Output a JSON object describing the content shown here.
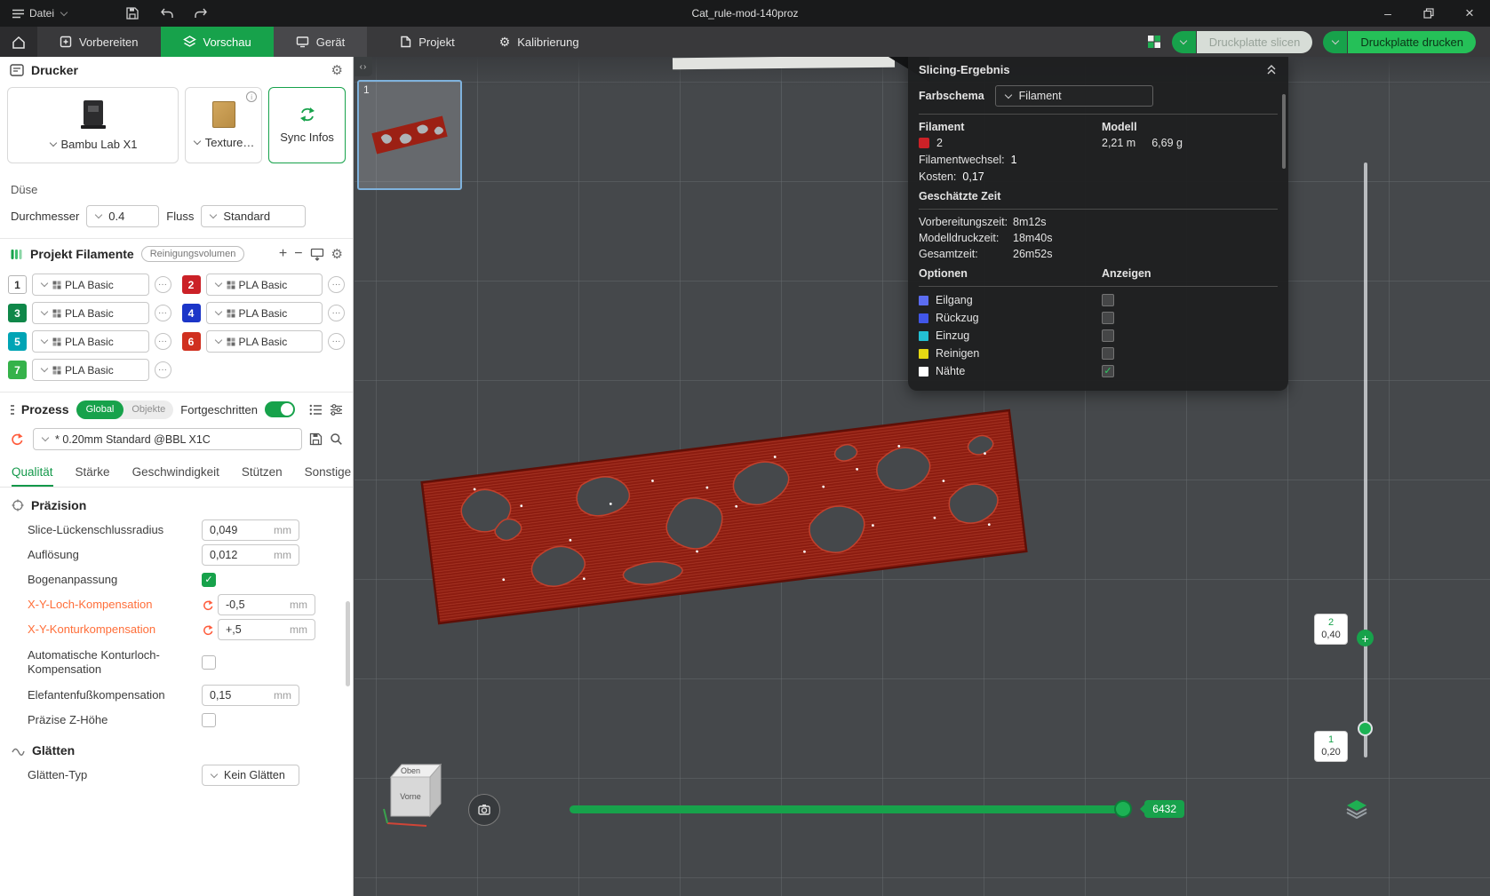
{
  "titlebar": {
    "menu": "Datei",
    "title": "Cat_rule-mod-140proz"
  },
  "navbar": {
    "tabs": [
      {
        "label": "Vorbereiten"
      },
      {
        "label": "Vorschau"
      },
      {
        "label": "Gerät"
      },
      {
        "label": "Projekt"
      },
      {
        "label": "Kalibrierung"
      }
    ],
    "active_tab": "Vorschau",
    "slice_button": "Druckplatte slicen",
    "print_button": "Druckplatte drucken"
  },
  "colors": {
    "accent_green": "#17a24b",
    "print_button_green": "#25c058",
    "modified_orange": "#ff6e39",
    "model_red": "#8c1c10"
  },
  "printer": {
    "title": "Drucker",
    "name": "Bambu Lab X1",
    "plate_type": "Texture…",
    "sync_button": "Sync Infos",
    "nozzle_title": "Düse",
    "diameter_label": "Durchmesser",
    "diameter_value": "0.4",
    "flow_label": "Fluss",
    "flow_value": "Standard"
  },
  "filaments": {
    "title": "Projekt Filamente",
    "flush_button": "Reinigungsvolumen",
    "items": [
      {
        "num": "1",
        "color": "#ffffff",
        "label": "PLA Basic"
      },
      {
        "num": "2",
        "color": "#cb2127",
        "label": "PLA Basic"
      },
      {
        "num": "3",
        "color": "#0f8749",
        "label": "PLA Basic"
      },
      {
        "num": "4",
        "color": "#1b35c8",
        "label": "PLA Basic"
      },
      {
        "num": "5",
        "color": "#00a4b5",
        "label": "PLA Basic"
      },
      {
        "num": "6",
        "color": "#d0301f",
        "label": "PLA Basic"
      },
      {
        "num": "7",
        "color": "#35b24a",
        "label": "PLA Basic"
      }
    ]
  },
  "process": {
    "title": "Prozess",
    "scope_global": "Global",
    "scope_objects": "Objekte",
    "advanced_label": "Fortgeschritten",
    "advanced_on": true,
    "preset": "* 0.20mm Standard @BBL X1C",
    "tabs": [
      "Qualität",
      "Stärke",
      "Geschwindigkeit",
      "Stützen",
      "Sonstige"
    ],
    "active_tab": "Qualität"
  },
  "quality": {
    "precision_title": "Präzision",
    "rows": [
      {
        "label": "Slice-Lückenschlussradius",
        "value": "0,049",
        "unit": "mm",
        "type": "input",
        "modified": false
      },
      {
        "label": "Auflösung",
        "value": "0,012",
        "unit": "mm",
        "type": "input",
        "modified": false
      },
      {
        "label": "Bogenanpassung",
        "type": "checkbox",
        "checked": true
      },
      {
        "label": "X-Y-Loch-Kompensation",
        "value": "-0,5",
        "unit": "mm",
        "type": "input",
        "modified": true
      },
      {
        "label": "X-Y-Konturkompensation",
        "value": "+,5",
        "unit": "mm",
        "type": "input",
        "modified": true
      },
      {
        "label": "Automatische Konturloch-Kompensation",
        "type": "checkbox",
        "checked": false
      },
      {
        "label": "Elefantenfußkompensation",
        "value": "0,15",
        "unit": "mm",
        "type": "input",
        "modified": false
      },
      {
        "label": "Präzise Z-Höhe",
        "type": "checkbox",
        "checked": false
      }
    ],
    "smooth_title": "Glätten",
    "smooth_type_label": "Glätten-Typ",
    "smooth_type_value": "Kein Glätten"
  },
  "slicing": {
    "title": "Slicing-Ergebnis",
    "color_scheme_label": "Farbschema",
    "color_scheme_value": "Filament",
    "col_filament": "Filament",
    "col_model": "Modell",
    "filament_row": {
      "num": "2",
      "color": "#cb2127",
      "length": "2,21 m",
      "weight": "6,69 g"
    },
    "change_label": "Filamentwechsel:",
    "change_value": "1",
    "cost_label": "Kosten:",
    "cost_value": "0,17",
    "time_title": "Geschätzte Zeit",
    "times": [
      {
        "label": "Vorbereitungszeit:",
        "value": "8m12s"
      },
      {
        "label": "Modelldruckzeit:",
        "value": "18m40s"
      },
      {
        "label": "Gesamtzeit:",
        "value": "26m52s"
      }
    ],
    "options_title": "Optionen",
    "show_title": "Anzeigen",
    "options": [
      {
        "label": "Eilgang",
        "color": "#5b6cf0",
        "checked": false
      },
      {
        "label": "Rückzug",
        "color": "#4156e8",
        "checked": false
      },
      {
        "label": "Einzug",
        "color": "#23c0d4",
        "checked": false
      },
      {
        "label": "Reinigen",
        "color": "#e6d813",
        "checked": false
      },
      {
        "label": "Nähte",
        "color": "#ffffff",
        "checked": true
      }
    ]
  },
  "viewport": {
    "plate_number": "1",
    "cube_top": "Oben",
    "cube_front": "Vorne",
    "progress_value": "6432",
    "layer_upper": {
      "num": "2",
      "height": "0,40"
    },
    "layer_lower": {
      "num": "1",
      "height": "0,20"
    }
  }
}
